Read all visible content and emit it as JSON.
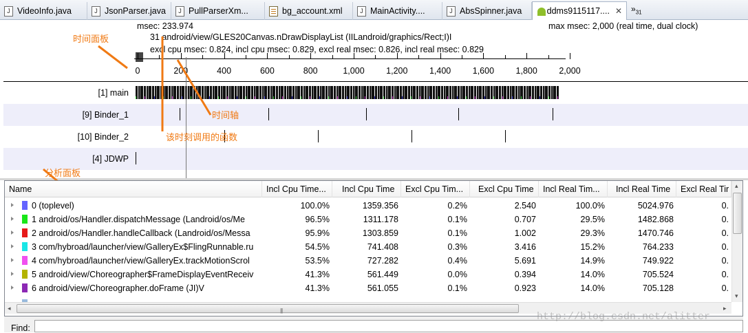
{
  "tabs": [
    {
      "label": "VideoInfo.java",
      "icon": "java-file-icon"
    },
    {
      "label": "JsonParser.java",
      "icon": "java-file-icon"
    },
    {
      "label": "PullParserXm...",
      "icon": "java-file-icon"
    },
    {
      "label": "bg_account.xml",
      "icon": "xml-file-icon"
    },
    {
      "label": "MainActivity....",
      "icon": "java-file-icon"
    },
    {
      "label": "AbsSpinner.java",
      "icon": "java-file-icon"
    },
    {
      "label": "ddms9115117....",
      "icon": "android-icon",
      "active": true,
      "close": "✕"
    }
  ],
  "overflow": {
    "chevron": "»",
    "count": "31"
  },
  "timeline": {
    "msec": "msec: 233.974",
    "max_msec": "max msec: 2,000 (real time, dual clock)",
    "method": "31 android/view/GLES20Canvas.nDrawDisplayList (IILandroid/graphics/Rect;I)I",
    "stats": "excl cpu msec: 0.824, incl cpu msec: 0.829, excl real msec: 0.826, incl real msec: 0.829",
    "ruler_labels": [
      "0",
      "200",
      "400",
      "600",
      "800",
      "1,000",
      "1,200",
      "1,400",
      "1,600",
      "1,800",
      "2,000"
    ],
    "threads": [
      {
        "label": "[1] main"
      },
      {
        "label": "[9] Binder_1"
      },
      {
        "label": "[10] Binder_2"
      },
      {
        "label": "[4] JDWP"
      }
    ]
  },
  "annotations": {
    "time_panel": "时间面板",
    "time_axis": "时间轴",
    "current_function": "该时刻调用的函数",
    "analysis_panel": "分析面板"
  },
  "profile": {
    "headers": [
      "Name",
      "Incl Cpu Time...",
      "Incl Cpu Time",
      "Excl Cpu Tim...",
      "Excl Cpu Time",
      "Incl Real Tim...",
      "Incl Real Time",
      "Excl Real Tir"
    ],
    "rows": [
      {
        "color": "#6464ff",
        "name": "0 (toplevel)",
        "c1": "100.0%",
        "c2": "1359.356",
        "c3": "0.2%",
        "c4": "2.540",
        "c5": "100.0%",
        "c6": "5024.976",
        "c7": "0."
      },
      {
        "color": "#19e619",
        "name": "1 android/os/Handler.dispatchMessage (Landroid/os/Me",
        "c1": "96.5%",
        "c2": "1311.178",
        "c3": "0.1%",
        "c4": "0.707",
        "c5": "29.5%",
        "c6": "1482.868",
        "c7": "0."
      },
      {
        "color": "#e61919",
        "name": "2 android/os/Handler.handleCallback (Landroid/os/Messa",
        "c1": "95.9%",
        "c2": "1303.859",
        "c3": "0.1%",
        "c4": "1.002",
        "c5": "29.3%",
        "c6": "1470.746",
        "c7": "0."
      },
      {
        "color": "#19e6e6",
        "name": "3 com/hybroad/launcher/view/GalleryEx$FlingRunnable.ru",
        "c1": "54.5%",
        "c2": "741.408",
        "c3": "0.3%",
        "c4": "3.416",
        "c5": "15.2%",
        "c6": "764.233",
        "c7": "0."
      },
      {
        "color": "#f050f0",
        "name": "4 com/hybroad/launcher/view/GalleryEx.trackMotionScrol",
        "c1": "53.5%",
        "c2": "727.282",
        "c3": "0.4%",
        "c4": "5.691",
        "c5": "14.9%",
        "c6": "749.922",
        "c7": "0."
      },
      {
        "color": "#b4b400",
        "name": "5 android/view/Choreographer$FrameDisplayEventReceiv",
        "c1": "41.3%",
        "c2": "561.449",
        "c3": "0.0%",
        "c4": "0.394",
        "c5": "14.0%",
        "c6": "705.524",
        "c7": "0."
      },
      {
        "color": "#8c28b4",
        "name": "6 android/view/Choreographer.doFrame (JI)V",
        "c1": "41.3%",
        "c2": "561.055",
        "c3": "0.1%",
        "c4": "0.923",
        "c5": "14.0%",
        "c6": "705.128",
        "c7": "0."
      }
    ]
  },
  "find": {
    "label": "Find:",
    "value": ""
  },
  "watermark": "http://blog.csdn.net/alitter"
}
